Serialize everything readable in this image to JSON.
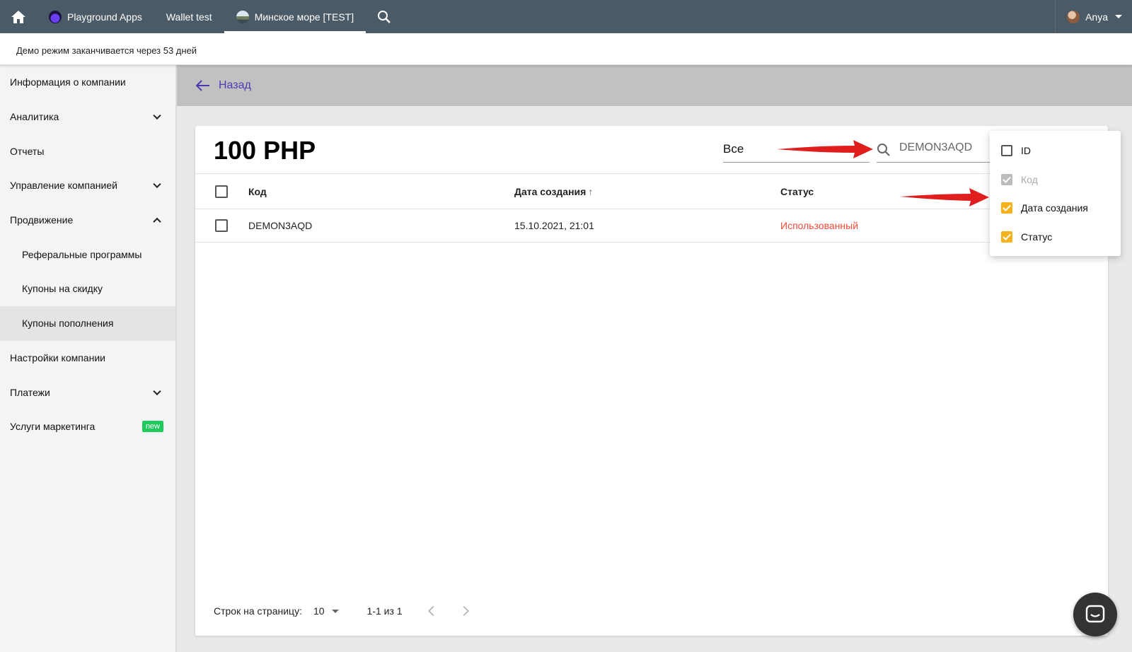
{
  "topbar": {
    "tabs": [
      {
        "label": "Playground Apps"
      },
      {
        "label": "Wallet test"
      },
      {
        "label": "Минское море [TEST]"
      }
    ],
    "user": "Anya"
  },
  "banner": "Демо режим заканчивается через 53 дней",
  "sidebar": {
    "items": [
      {
        "label": "Информация о компании"
      },
      {
        "label": "Аналитика"
      },
      {
        "label": "Отчеты"
      },
      {
        "label": "Управление компанией"
      },
      {
        "label": "Продвижение"
      },
      {
        "label": "Реферальные программы"
      },
      {
        "label": "Купоны на скидку"
      },
      {
        "label": "Купоны пополнения"
      },
      {
        "label": "Настройки компании"
      },
      {
        "label": "Платежи"
      },
      {
        "label": "Услуги маркетинга"
      }
    ],
    "new_badge": "new"
  },
  "back": {
    "label": "Назад"
  },
  "card": {
    "title": "100 PHP",
    "filter_value": "Все",
    "search_value": "DEMON3AQD"
  },
  "table": {
    "headers": {
      "code": "Код",
      "created": "Дата создания",
      "status": "Статус"
    },
    "rows": [
      {
        "code": "DEMON3AQD",
        "created": "15.10.2021, 21:01",
        "status": "Использованный"
      }
    ]
  },
  "pagination": {
    "rows_label": "Строк на страницу:",
    "rows_value": "10",
    "range": "1-1 из 1"
  },
  "column_menu": {
    "items": [
      {
        "label": "ID",
        "checked": false
      },
      {
        "label": "Код",
        "checked": true
      },
      {
        "label": "Дата создания",
        "checked": true
      },
      {
        "label": "Статус",
        "checked": true
      }
    ]
  },
  "colors": {
    "topbar": "#4a5a66",
    "accent_purple": "#4b3bb3",
    "checkbox_orange": "#f6b21b",
    "status_red": "#f04a3a",
    "arrow_red": "#e01e1e",
    "badge_green": "#1fc95c"
  }
}
